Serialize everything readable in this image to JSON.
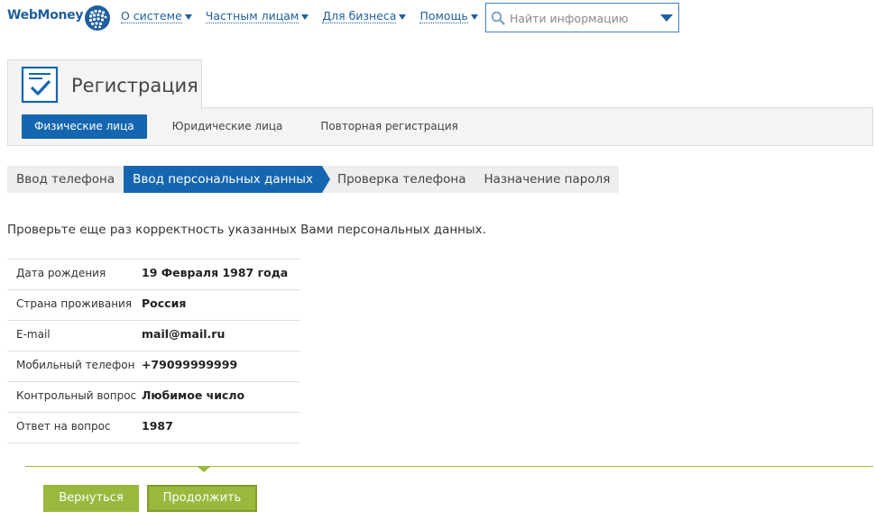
{
  "header": {
    "logo_text": "WebMoney",
    "nav": [
      {
        "label": "О системе"
      },
      {
        "label": "Частным лицам"
      },
      {
        "label": "Для бизнеса"
      },
      {
        "label": "Помощь"
      }
    ],
    "search": {
      "placeholder": "Найти информацию",
      "icon": "search-icon"
    }
  },
  "registration": {
    "title": "Регистрация",
    "icon": "checklist-icon",
    "type_tabs": [
      {
        "label": "Физические лица",
        "active": true
      },
      {
        "label": "Юридические лица",
        "active": false
      },
      {
        "label": "Повторная регистрация",
        "active": false
      }
    ],
    "steps": [
      {
        "label": "Ввод телефона",
        "active": false
      },
      {
        "label": "Ввод персональных данных",
        "active": true
      },
      {
        "label": "Проверка телефона",
        "active": false
      },
      {
        "label": "Назначение пароля",
        "active": false
      }
    ]
  },
  "content": {
    "intro": "Проверьте еще раз корректность указанных Вами персональных данных.",
    "rows": [
      {
        "label": "Дата рождения",
        "value": "19 Февраля 1987 года"
      },
      {
        "label": "Страна проживания",
        "value": "Россия"
      },
      {
        "label": "E-mail",
        "value": "mail@mail.ru"
      },
      {
        "label": "Мобильный телефон",
        "value": "+79099999999"
      },
      {
        "label": "Контрольный вопрос",
        "value": "Любимое число"
      },
      {
        "label": "Ответ на вопрос",
        "value": "1987"
      }
    ]
  },
  "actions": {
    "back_label": "Вернуться",
    "continue_label": "Продолжить"
  },
  "colors": {
    "brand_blue": "#1566b0",
    "link_blue": "#1f5f9e",
    "button_green": "#99b83d",
    "divider_green": "#9bbb3a"
  }
}
